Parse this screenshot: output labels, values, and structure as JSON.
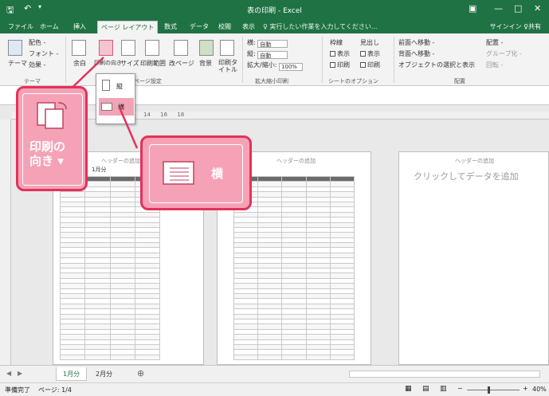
{
  "window": {
    "title": "表の印刷 - Excel"
  },
  "tabs": [
    {
      "label": "ファイル"
    },
    {
      "label": "ホーム"
    },
    {
      "label": "挿入"
    },
    {
      "label": "ページ レイアウト"
    },
    {
      "label": "数式"
    },
    {
      "label": "データ"
    },
    {
      "label": "校閲"
    },
    {
      "label": "表示"
    }
  ],
  "tell_me": {
    "placeholder": "♀ 実行したい作業を入力してください..."
  },
  "account": {
    "signin": "サインイン",
    "share": "♀共有"
  },
  "ribbon": {
    "theme_label": "テーマ",
    "theme_colors": "配色 -",
    "theme_fonts": "フォント -",
    "theme_effects": "効果 -",
    "themes_group": "テーマ",
    "margins_label": "余白",
    "orientation_label": "印刷の向き",
    "size_label": "サイズ",
    "print_area_label": "印刷範囲",
    "breaks_label": "改ページ",
    "background_label": "背景",
    "print_titles_label": "印刷タイトル",
    "page_setup_group": "ページ設定",
    "width_label": "横:",
    "height_label": "縦:",
    "width_value": "自動",
    "height_value": "自動",
    "scale_label": "拡大/縮小:",
    "scale_value": "100%",
    "scale_group": "拡大縮小印刷",
    "gridlines_label": "枠線",
    "headings_label": "見出し",
    "view_label": "表示",
    "print_label": "印刷",
    "sheet_options_group": "シートのオプション",
    "bring_forward": "前面へ移動 -",
    "send_backward": "背面へ移動 -",
    "selection_pane": "オブジェクトの選択と表示",
    "align": "配置 -",
    "group": "グループ化 -",
    "rotate": "回転 -",
    "arrange_group": "配置"
  },
  "orientation_menu": {
    "portrait": "縦",
    "landscape": "横"
  },
  "callouts": {
    "orientation_big": "印刷の\n向き ▾",
    "landscape_big": "横"
  },
  "ruler": {
    "marks": [
      "14",
      "16",
      "18"
    ]
  },
  "sheet": {
    "page_header_placeholder": "ヘッダーの追加",
    "add_data_placeholder": "クリックしてデータを追加",
    "tab_label_cell": "1月分"
  },
  "sheet_tabs": [
    {
      "label": "1月分"
    },
    {
      "label": "2月分"
    }
  ],
  "status": {
    "ready": "準備完了",
    "page_info": "ページ: 1/4",
    "zoom": "40%"
  },
  "colors": {
    "accent": "#1f7244",
    "callout_border": "#e3325a",
    "callout_fill": "#f6a2b6"
  }
}
